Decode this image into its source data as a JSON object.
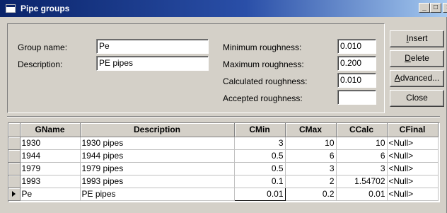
{
  "window": {
    "title": "Pipe groups"
  },
  "form": {
    "group_name_label": "Group name:",
    "group_name_value": "Pe",
    "description_label": "Description:",
    "description_value": "PE pipes",
    "min_roughness_label": "Minimum roughness:",
    "min_roughness_value": "0.010",
    "max_roughness_label": "Maximum roughness:",
    "max_roughness_value": "0.200",
    "calc_roughness_label": "Calculated roughness:",
    "calc_roughness_value": "0.010",
    "accepted_roughness_label": "Accepted roughness:",
    "accepted_roughness_value": ""
  },
  "buttons": {
    "insert": {
      "first": "I",
      "rest": "nsert"
    },
    "delete": {
      "first": "D",
      "rest": "elete"
    },
    "advanced": {
      "first": "A",
      "rest": "dvanced..."
    },
    "close": "Close"
  },
  "grid": {
    "columns": [
      "GName",
      "Description",
      "CMin",
      "CMax",
      "CCalc",
      "CFinal"
    ],
    "rows": [
      {
        "gname": "1930",
        "description": "1930 pipes",
        "cmin": "3",
        "cmax": "10",
        "ccalc": "10",
        "cfinal": "<Null>"
      },
      {
        "gname": "1944",
        "description": "1944 pipes",
        "cmin": "0.5",
        "cmax": "6",
        "ccalc": "6",
        "cfinal": "<Null>"
      },
      {
        "gname": "1979",
        "description": "1979 pipes",
        "cmin": "0.5",
        "cmax": "3",
        "ccalc": "3",
        "cfinal": "<Null>"
      },
      {
        "gname": "1993",
        "description": "1993 pipes",
        "cmin": "0.1",
        "cmax": "2",
        "ccalc": "1.54702",
        "cfinal": "<Null>"
      },
      {
        "gname": "Pe",
        "description": "PE pipes",
        "cmin": "0.01",
        "cmax": "0.2",
        "ccalc": "0.01",
        "cfinal": "<Null>"
      }
    ]
  }
}
